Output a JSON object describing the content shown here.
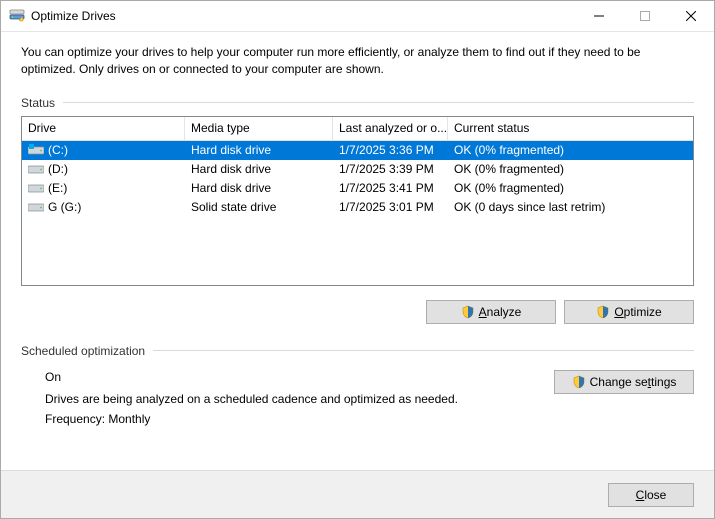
{
  "window_title": "Optimize Drives",
  "description": "You can optimize your drives to help your computer run more efficiently, or analyze them to find out if they need to be optimized. Only drives on or connected to your computer are shown.",
  "status_label": "Status",
  "columns": {
    "drive": "Drive",
    "media": "Media type",
    "last": "Last analyzed or o...",
    "current": "Current status"
  },
  "drives": [
    {
      "name": "(C:)",
      "media": "Hard disk drive",
      "last": "1/7/2025 3:36 PM",
      "status": "OK (0% fragmented)",
      "selected": true,
      "icon": "win"
    },
    {
      "name": "(D:)",
      "media": "Hard disk drive",
      "last": "1/7/2025 3:39 PM",
      "status": "OK (0% fragmented)",
      "selected": false,
      "icon": "hdd"
    },
    {
      "name": "(E:)",
      "media": "Hard disk drive",
      "last": "1/7/2025 3:41 PM",
      "status": "OK (0% fragmented)",
      "selected": false,
      "icon": "hdd"
    },
    {
      "name": "G (G:)",
      "media": "Solid state drive",
      "last": "1/7/2025 3:01 PM",
      "status": "OK (0 days since last retrim)",
      "selected": false,
      "icon": "ssd"
    }
  ],
  "buttons": {
    "analyze": "Analyze",
    "optimize": "Optimize",
    "change_settings": "Change settings",
    "close": "Close"
  },
  "scheduled_label": "Scheduled optimization",
  "scheduled": {
    "state": "On",
    "desc": "Drives are being analyzed on a scheduled cadence and optimized as needed.",
    "frequency": "Frequency: Monthly"
  }
}
